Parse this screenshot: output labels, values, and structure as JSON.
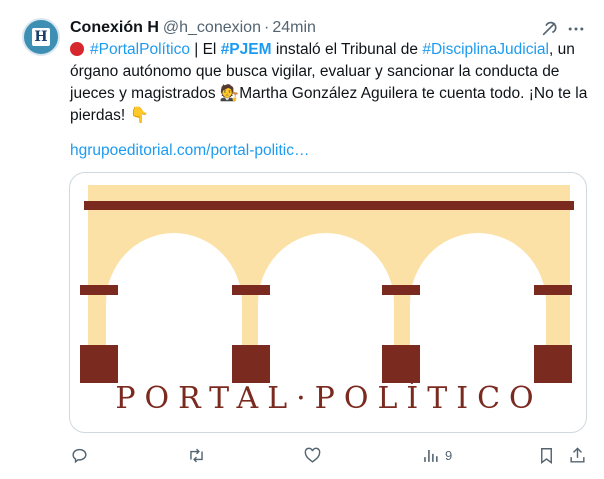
{
  "tweet": {
    "author_name": "Conexión H",
    "author_handle": "@h_conexion",
    "separator": "·",
    "time": "24min",
    "text": {
      "t1": "#PortalPolítico",
      "t2": " | El ",
      "t3": "#PJEM",
      "t4": " instaló el Tribunal de ",
      "t5": "#DisciplinaJudicial",
      "t6": ", un órgano autónomo que busca vigilar, evaluar y sancionar la conducta de jueces y magistrados ",
      "t7": "🧑‍⚖️",
      "t8": "Martha González Aguilera te cuenta todo. ¡No te la pierdas! ",
      "t9": "👇"
    },
    "link": "hgrupoeditorial.com/portal-politic…",
    "card": {
      "logo_text": "PORTAL·POLÍTICO"
    },
    "views_count": "9"
  },
  "colors": {
    "accent": "#1d9bf0",
    "arch_fill": "#fbe1a6",
    "arch_dark": "#7b2a20",
    "muted": "#536471"
  },
  "icons": [
    "grok-icon",
    "more-icon",
    "reply-icon",
    "retweet-icon",
    "like-icon",
    "views-icon",
    "bookmark-icon",
    "share-icon"
  ]
}
